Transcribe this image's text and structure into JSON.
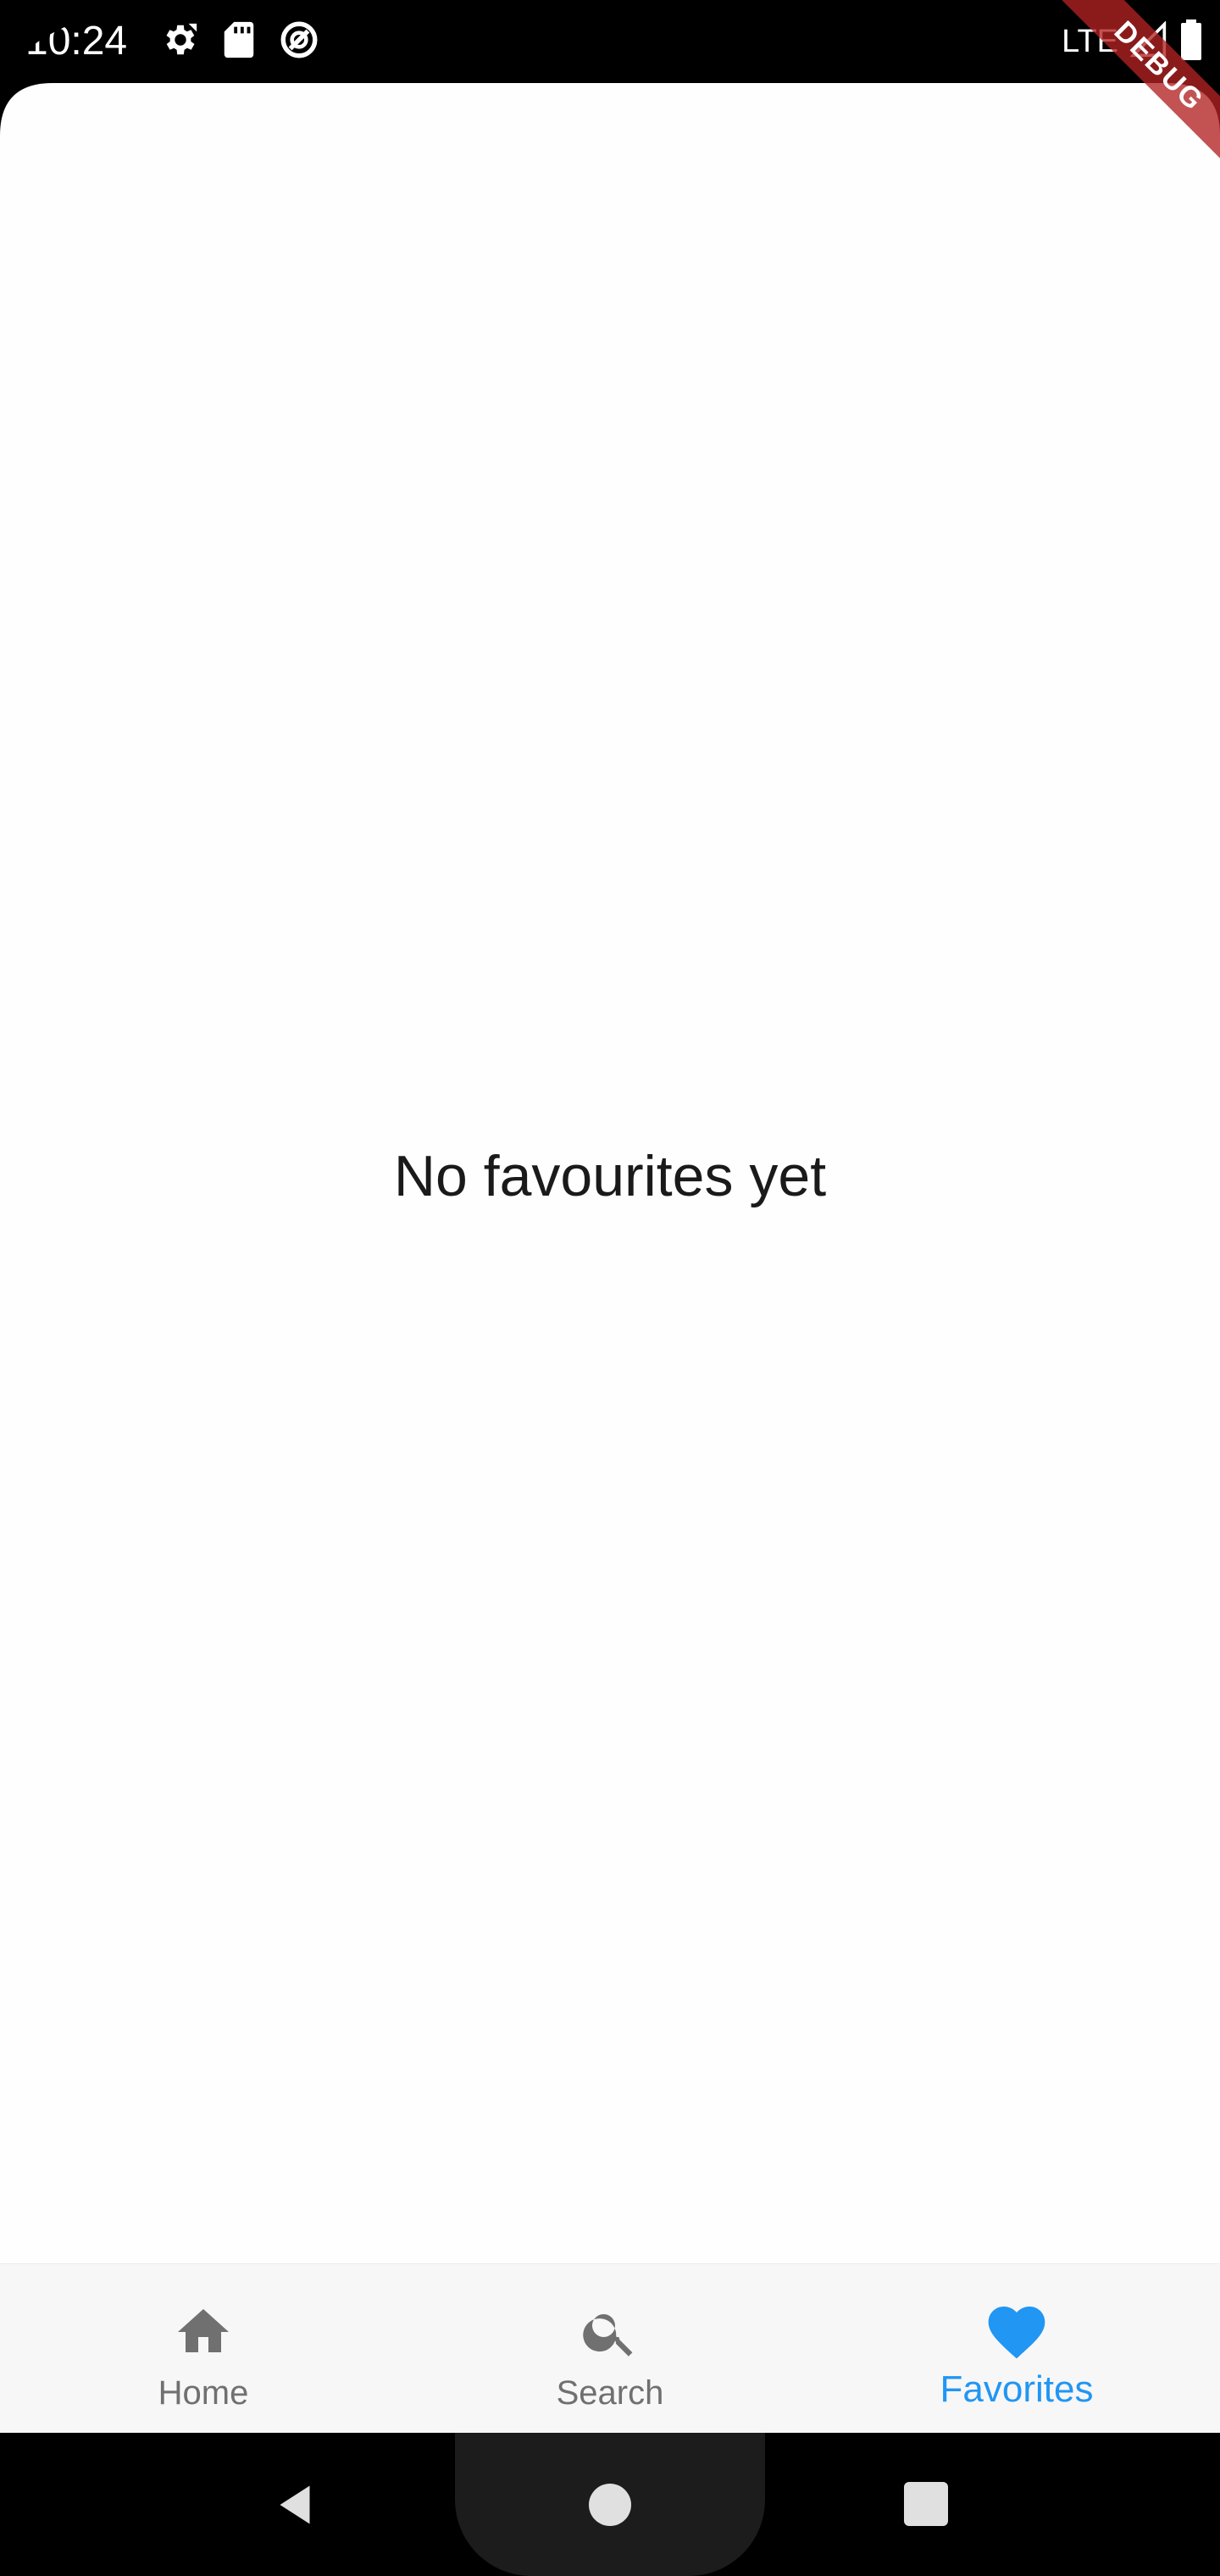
{
  "status_bar": {
    "time": "10:24",
    "network": "LTE",
    "icons": [
      "settings-icon",
      "sd-card-icon",
      "data-saver-icon",
      "signal-icon",
      "battery-icon"
    ]
  },
  "debug_banner": {
    "label": "DEBUG"
  },
  "main": {
    "empty_message": "No favourites yet"
  },
  "bottom_nav": {
    "items": [
      {
        "label": "Home",
        "icon": "home-icon",
        "active": false
      },
      {
        "label": "Search",
        "icon": "search-icon",
        "active": false
      },
      {
        "label": "Favorites",
        "icon": "heart-icon",
        "active": true
      }
    ]
  },
  "colors": {
    "accent": "#2196f3",
    "inactive": "#707070",
    "nav_background": "#f7f7f7",
    "debug_ribbon": "#b22222"
  },
  "system_nav": {
    "buttons": [
      "back-icon",
      "home-circle-icon",
      "recents-icon"
    ]
  }
}
